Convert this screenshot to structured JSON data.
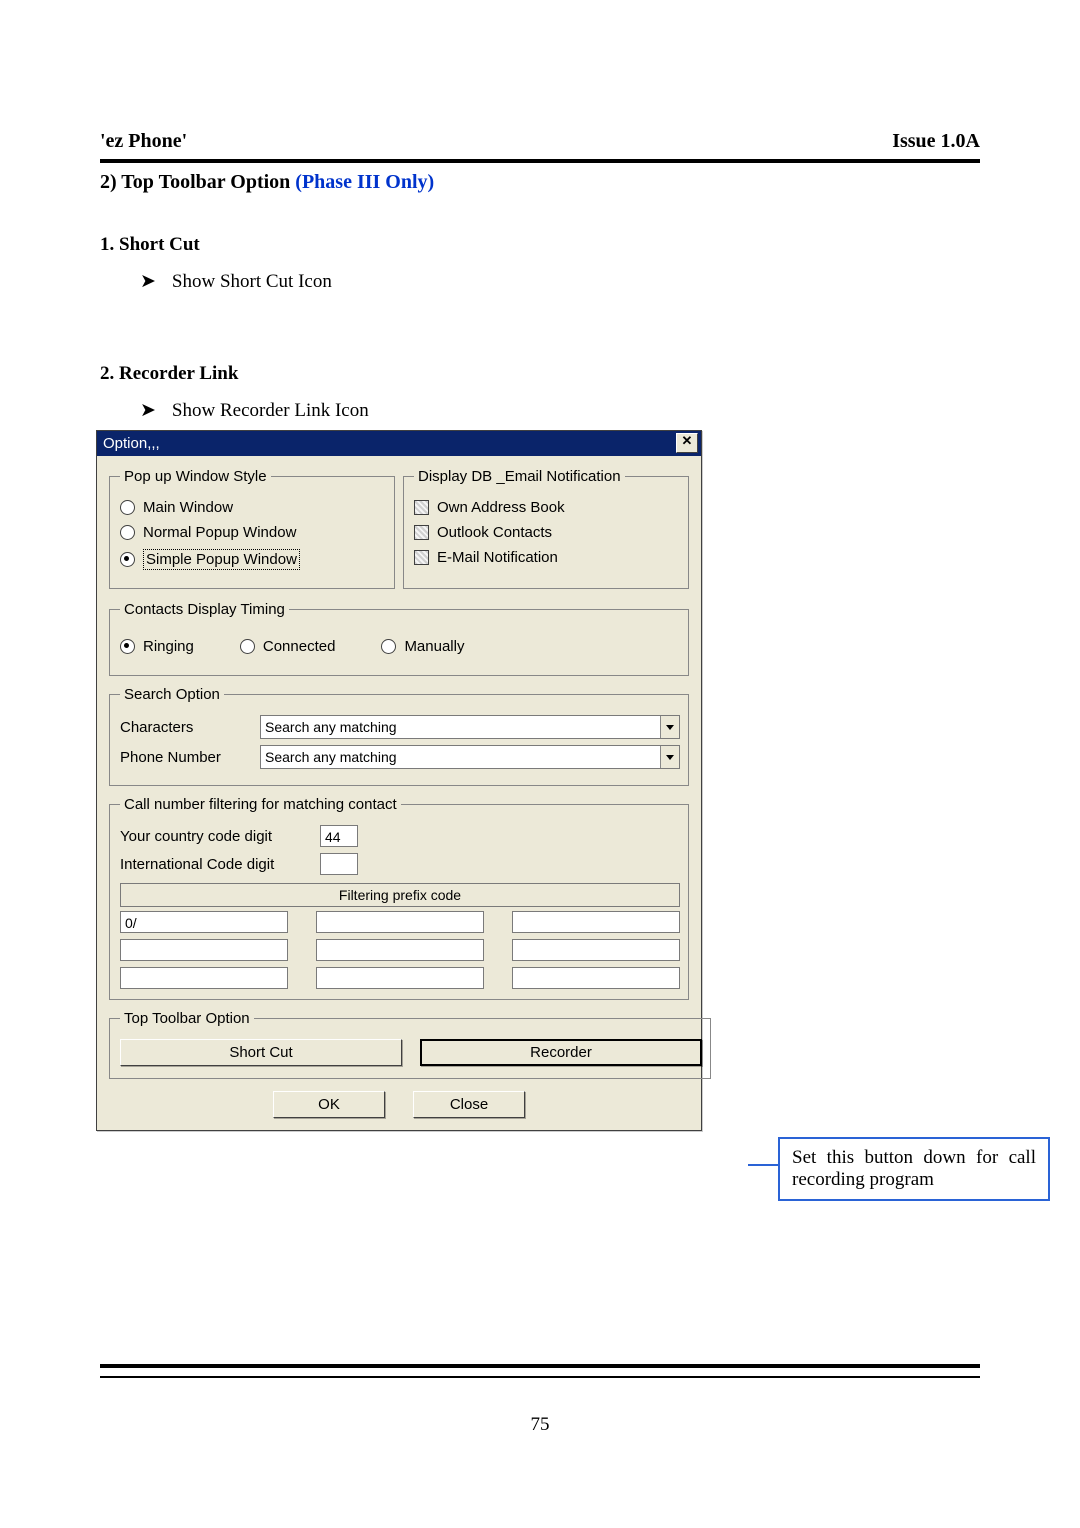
{
  "header": {
    "app": "'ez Phone'",
    "issue": "Issue 1.0A"
  },
  "section": {
    "title_prefix": "2) Top Toolbar Option ",
    "title_phase": "(Phase III Only)"
  },
  "sub1": {
    "heading": "1. Short Cut",
    "bullet": "Show Short Cut Icon"
  },
  "sub2": {
    "heading": "2. Recorder Link",
    "bullet": "Show Recorder Link Icon"
  },
  "dialog": {
    "title": "Option,,,",
    "close_glyph": "✕",
    "popup_style": {
      "legend": "Pop up Window Style",
      "opts": [
        "Main Window",
        "Normal Popup Window",
        "Simple Popup Window"
      ],
      "selected_index": 2
    },
    "display_db": {
      "legend": "Display DB _Email Notification",
      "items": [
        "Own Address Book",
        "Outlook Contacts",
        "E-Mail Notification"
      ]
    },
    "timing": {
      "legend": "Contacts Display Timing",
      "opts": [
        "Ringing",
        "Connected",
        "Manually"
      ],
      "selected_index": 0
    },
    "search": {
      "legend": "Search Option",
      "rows": [
        {
          "label": "Characters",
          "value": "Search any matching"
        },
        {
          "label": "Phone Number",
          "value": "Search any matching"
        }
      ]
    },
    "filter": {
      "legend": "Call number filtering for matching contact",
      "rows": [
        {
          "label": "Your country code digit",
          "value": "44"
        },
        {
          "label": "International Code digit",
          "value": ""
        }
      ],
      "prefix_header": "Filtering prefix code",
      "prefix_cells": [
        "0/",
        "",
        "",
        "",
        "",
        "",
        "",
        "",
        ""
      ]
    },
    "top_toolbar": {
      "legend": "Top Toolbar Option",
      "shortcut": "Short Cut",
      "recorder": "Recorder"
    },
    "ok": "OK",
    "close": "Close"
  },
  "callout": "Set this button down for call recording program",
  "page_number": "75",
  "glyph": {
    "arrow": "➤"
  }
}
